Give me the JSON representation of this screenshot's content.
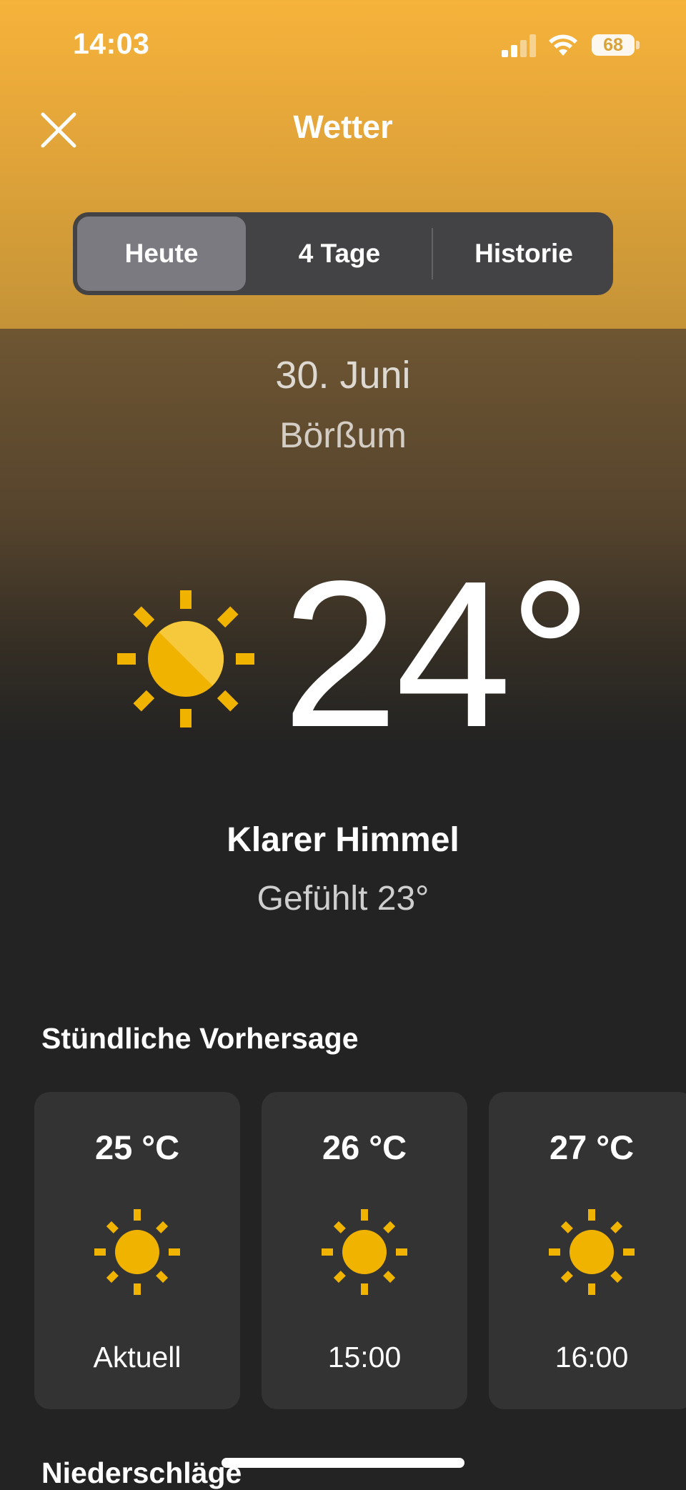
{
  "status_bar": {
    "time": "14:03",
    "battery_level": "68",
    "icons": [
      "cellular-signal-icon",
      "wifi-icon",
      "battery-icon"
    ]
  },
  "header": {
    "title": "Wetter",
    "close_icon": "close-icon"
  },
  "tabs": [
    {
      "label": "Heute",
      "active": true
    },
    {
      "label": "4 Tage",
      "active": false
    },
    {
      "label": "Historie",
      "active": false
    }
  ],
  "current": {
    "date": "30. Juni",
    "location": "Börßum",
    "temperature": "24°",
    "condition": "Klarer Himmel",
    "feels_like": "Gefühlt 23°",
    "icon": "sun-icon"
  },
  "hourly": {
    "title": "Stündliche Vorhersage",
    "items": [
      {
        "temp": "25 °C",
        "label": "Aktuell",
        "icon": "sun-icon"
      },
      {
        "temp": "26 °C",
        "label": "15:00",
        "icon": "sun-icon"
      },
      {
        "temp": "27 °C",
        "label": "16:00",
        "icon": "sun-icon"
      }
    ]
  },
  "precipitation": {
    "title": "Niederschläge"
  },
  "colors": {
    "accent_top": "#f6b33b",
    "background": "#232323",
    "card": "#333334",
    "sun": "#f0b400"
  }
}
